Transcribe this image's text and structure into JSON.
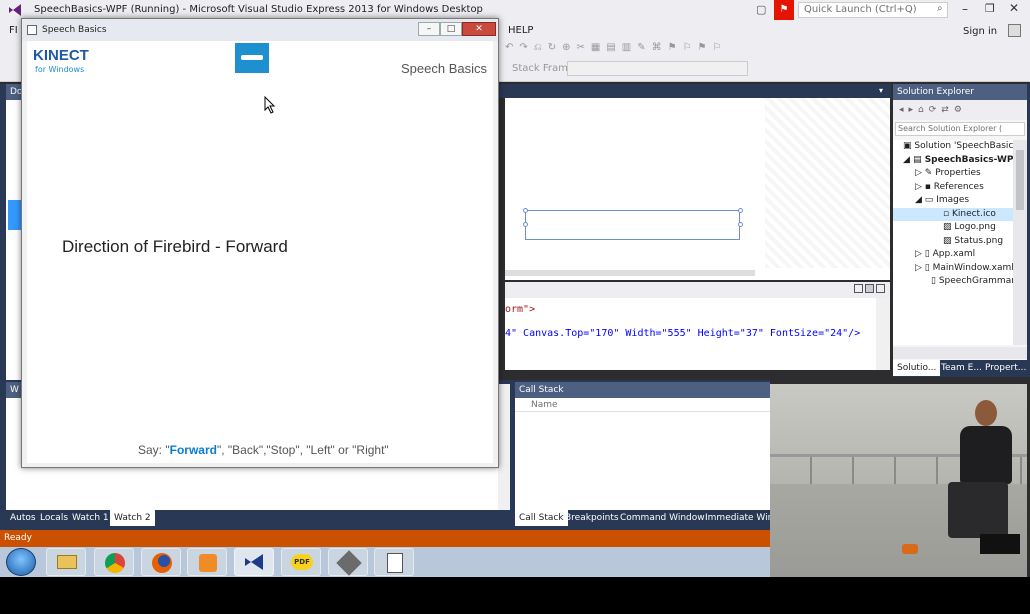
{
  "vs": {
    "window_title": "SpeechBasics-WPF (Running) - Microsoft Visual Studio Express 2013 for Windows Desktop",
    "quick_launch_placeholder": "Quick Launch (Ctrl+Q)",
    "sign_in": "Sign in",
    "menu": [
      "FI",
      "HELP"
    ],
    "stack_frame_label": "Stack Frame:",
    "left_header_top": "Do",
    "left_header_bottom": "W",
    "xml_line1": "orm\">",
    "xml_line2": "4\" Canvas.Top=\"170\" Width=\"555\" Height=\"37\" FontSize=\"24\"/>",
    "call_stack_title": "Call Stack",
    "call_stack_column": "Name",
    "bottom_tabs_left": [
      "Autos",
      "Locals",
      "Watch 1",
      "Watch 2"
    ],
    "bottom_tabs_right": [
      "Call Stack",
      "Breakpoints",
      "Command Window",
      "Immediate Wind"
    ],
    "status": "Ready"
  },
  "solution_explorer": {
    "title": "Solution Explorer",
    "search_placeholder": "Search Solution Explorer (",
    "items": [
      "Solution 'SpeechBasics-WP",
      "SpeechBasics-WPF",
      "Properties",
      "References",
      "Images",
      "Kinect.ico",
      "Logo.png",
      "Status.png",
      "App.xaml",
      "MainWindow.xaml",
      "SpeechGrammar.xml"
    ],
    "tabs": [
      "Solutio...",
      "Team E...",
      "Propert..."
    ]
  },
  "speech_window": {
    "title": "Speech Basics",
    "brand_top": "KINECT",
    "brand_bottom": "for Windows",
    "header": "Speech Basics",
    "direction_text": "Direction of Firebird - Forward",
    "say_prefix": "Say: \"",
    "say_highlight": "Forward",
    "say_rest": "\", \"Back\",\"Stop\", \"Left\" or \"Right\""
  },
  "taskbar": {
    "icons": [
      "start-orb-icon",
      "file-explorer-icon",
      "chrome-icon",
      "firefox-icon",
      "media-player-icon",
      "visual-studio-icon",
      "pdf-reader-icon",
      "tool-icon",
      "notepad-icon"
    ]
  },
  "colors": {
    "vs_accent": "#007acc",
    "status_bar": "#ca5100",
    "kinect_blue": "#1e90d0",
    "highlight_blue": "#0a7cd0"
  }
}
